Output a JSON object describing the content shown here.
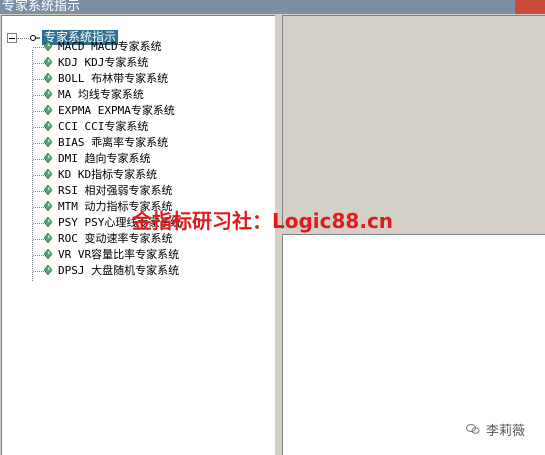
{
  "window": {
    "title": "专家系统指示"
  },
  "tree": {
    "root": {
      "label": "专家系统指示"
    },
    "items": [
      {
        "label": "MACD MACD专家系统"
      },
      {
        "label": "KDJ KDJ专家系统"
      },
      {
        "label": "BOLL 布林带专家系统"
      },
      {
        "label": "MA 均线专家系统"
      },
      {
        "label": "EXPMA EXPMA专家系统"
      },
      {
        "label": "CCI CCI专家系统"
      },
      {
        "label": "BIAS 乖离率专家系统"
      },
      {
        "label": "DMI 趋向专家系统"
      },
      {
        "label": "KD KD指标专家系统"
      },
      {
        "label": "RSI 相对强弱专家系统"
      },
      {
        "label": "MTM 动力指标专家系统"
      },
      {
        "label": "PSY PSY心理线专家系统"
      },
      {
        "label": "ROC 变动速率专家系统"
      },
      {
        "label": "VR VR容量比率专家系统"
      },
      {
        "label": "DPSJ 大盘随机专家系统"
      }
    ]
  },
  "overlay": {
    "watermark": "金指标研习社：Logic88.cn",
    "brand": "李莉薇"
  },
  "colors": {
    "item_icon": "#5aa36a",
    "selection": "#2f6f8f",
    "watermark": "#e11b1b"
  }
}
